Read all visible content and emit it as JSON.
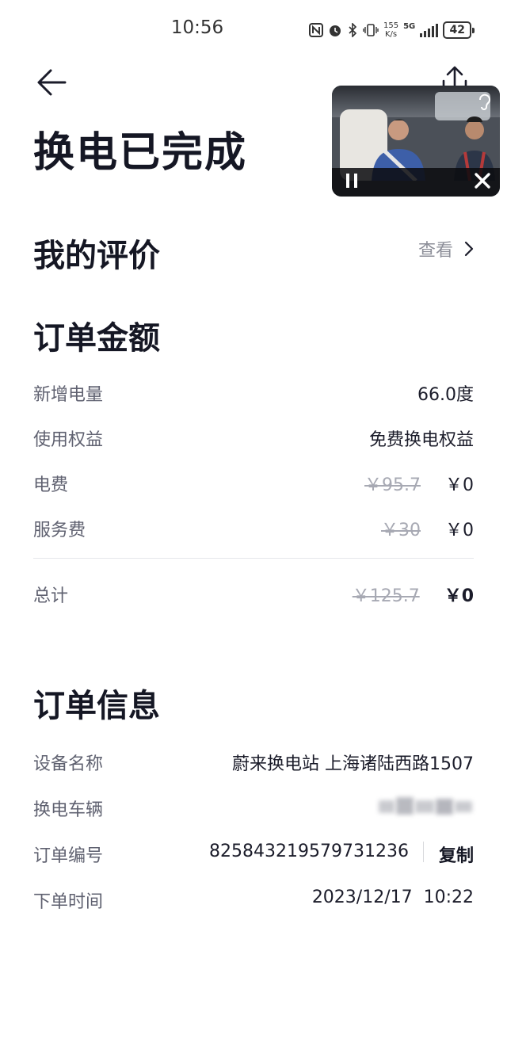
{
  "status_bar": {
    "time": "10:56",
    "net_speed_value": "155",
    "net_speed_unit": "K/s",
    "network": "5G",
    "battery": "42"
  },
  "header": {
    "title": "换电已完成",
    "back_icon": "arrow-left-icon",
    "share_icon": "share-icon"
  },
  "pip": {
    "icons": [
      "pause-icon",
      "close-icon",
      "ear-icon"
    ]
  },
  "rating": {
    "heading": "我的评价",
    "view_label": "查看"
  },
  "order_amount": {
    "heading": "订单金额",
    "rows": [
      {
        "label": "新增电量",
        "value": "66.0度"
      },
      {
        "label": "使用权益",
        "value": "免费换电权益"
      },
      {
        "label": "电费",
        "original": "￥95.7",
        "value": "￥0"
      },
      {
        "label": "服务费",
        "original": "￥30",
        "value": "￥0"
      }
    ],
    "total": {
      "label": "总计",
      "original": "￥125.7",
      "value": "￥0"
    }
  },
  "order_info": {
    "heading": "订单信息",
    "device_label": "设备名称",
    "device_value": "蔚来换电站 上海诸陆西路1507",
    "vehicle_label": "换电车辆",
    "order_no_label": "订单编号",
    "order_no_value": "825843219579731236",
    "copy_label": "复制",
    "time_label": "下单时间",
    "time_value": "2023/12/17  10:22"
  }
}
